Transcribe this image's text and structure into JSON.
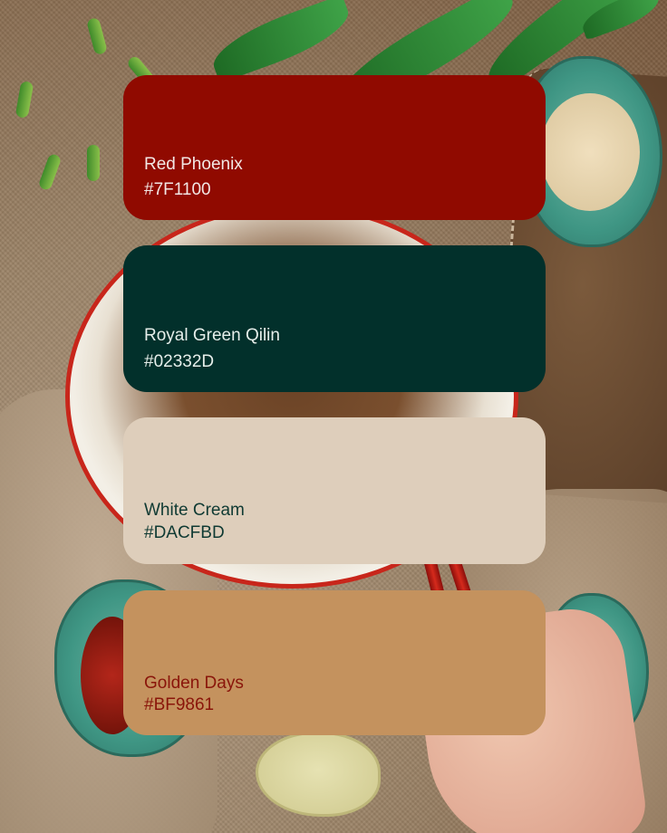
{
  "palette": {
    "colors": [
      {
        "name": "Red Phoenix",
        "hex": "#7F1100",
        "swatch": "#900a00",
        "text_color": "#f2e7e4"
      },
      {
        "name": "Royal Green Qilin",
        "hex": "#02332D",
        "swatch": "#02302b",
        "text_color": "#e6eeea"
      },
      {
        "name": "White Cream",
        "hex": "#DACFBD",
        "swatch": "#decebb",
        "text_color": "#0f3a33"
      },
      {
        "name": "Golden Days",
        "hex": "#BF9861",
        "swatch": "#c4925e",
        "text_color": "#8a150a"
      }
    ]
  },
  "background": {
    "image": "food-photo-noodle-bowl",
    "icons": [
      "leaf-icon",
      "bowl-icon",
      "sugar-dish-icon",
      "chili-dish-icon",
      "spoon-icon",
      "hand-icon",
      "chopsticks-icon"
    ]
  }
}
